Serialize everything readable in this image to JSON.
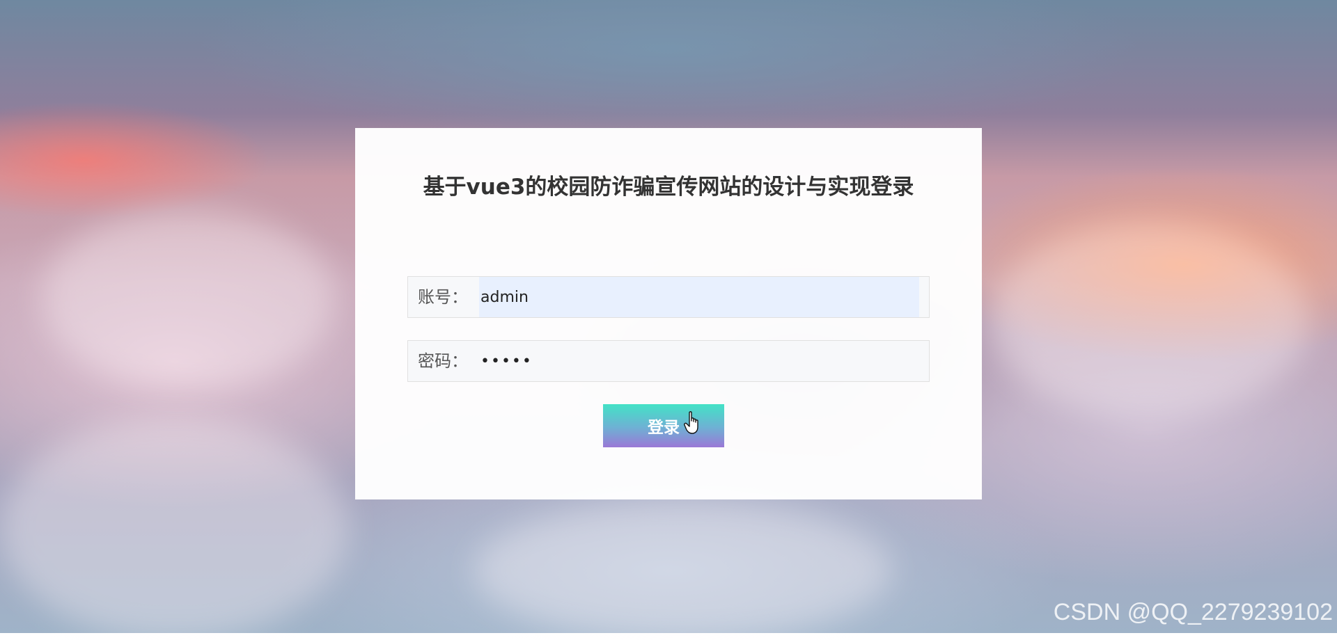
{
  "login": {
    "title": "基于vue3的校园防诈骗宣传网站的设计与实现登录",
    "account_label": "账号：",
    "account_value": "admin",
    "password_label": "密码：",
    "password_value": "admin",
    "submit_label": "登录"
  },
  "watermark": "CSDN @QQ_2279239102",
  "colors": {
    "button_gradient_top": "#43e2c6",
    "button_gradient_bottom": "#9a78d6",
    "autofill_background": "#e8f0fe",
    "title_text": "#333333"
  },
  "icons": {
    "cursor": "hand-pointer-icon"
  }
}
